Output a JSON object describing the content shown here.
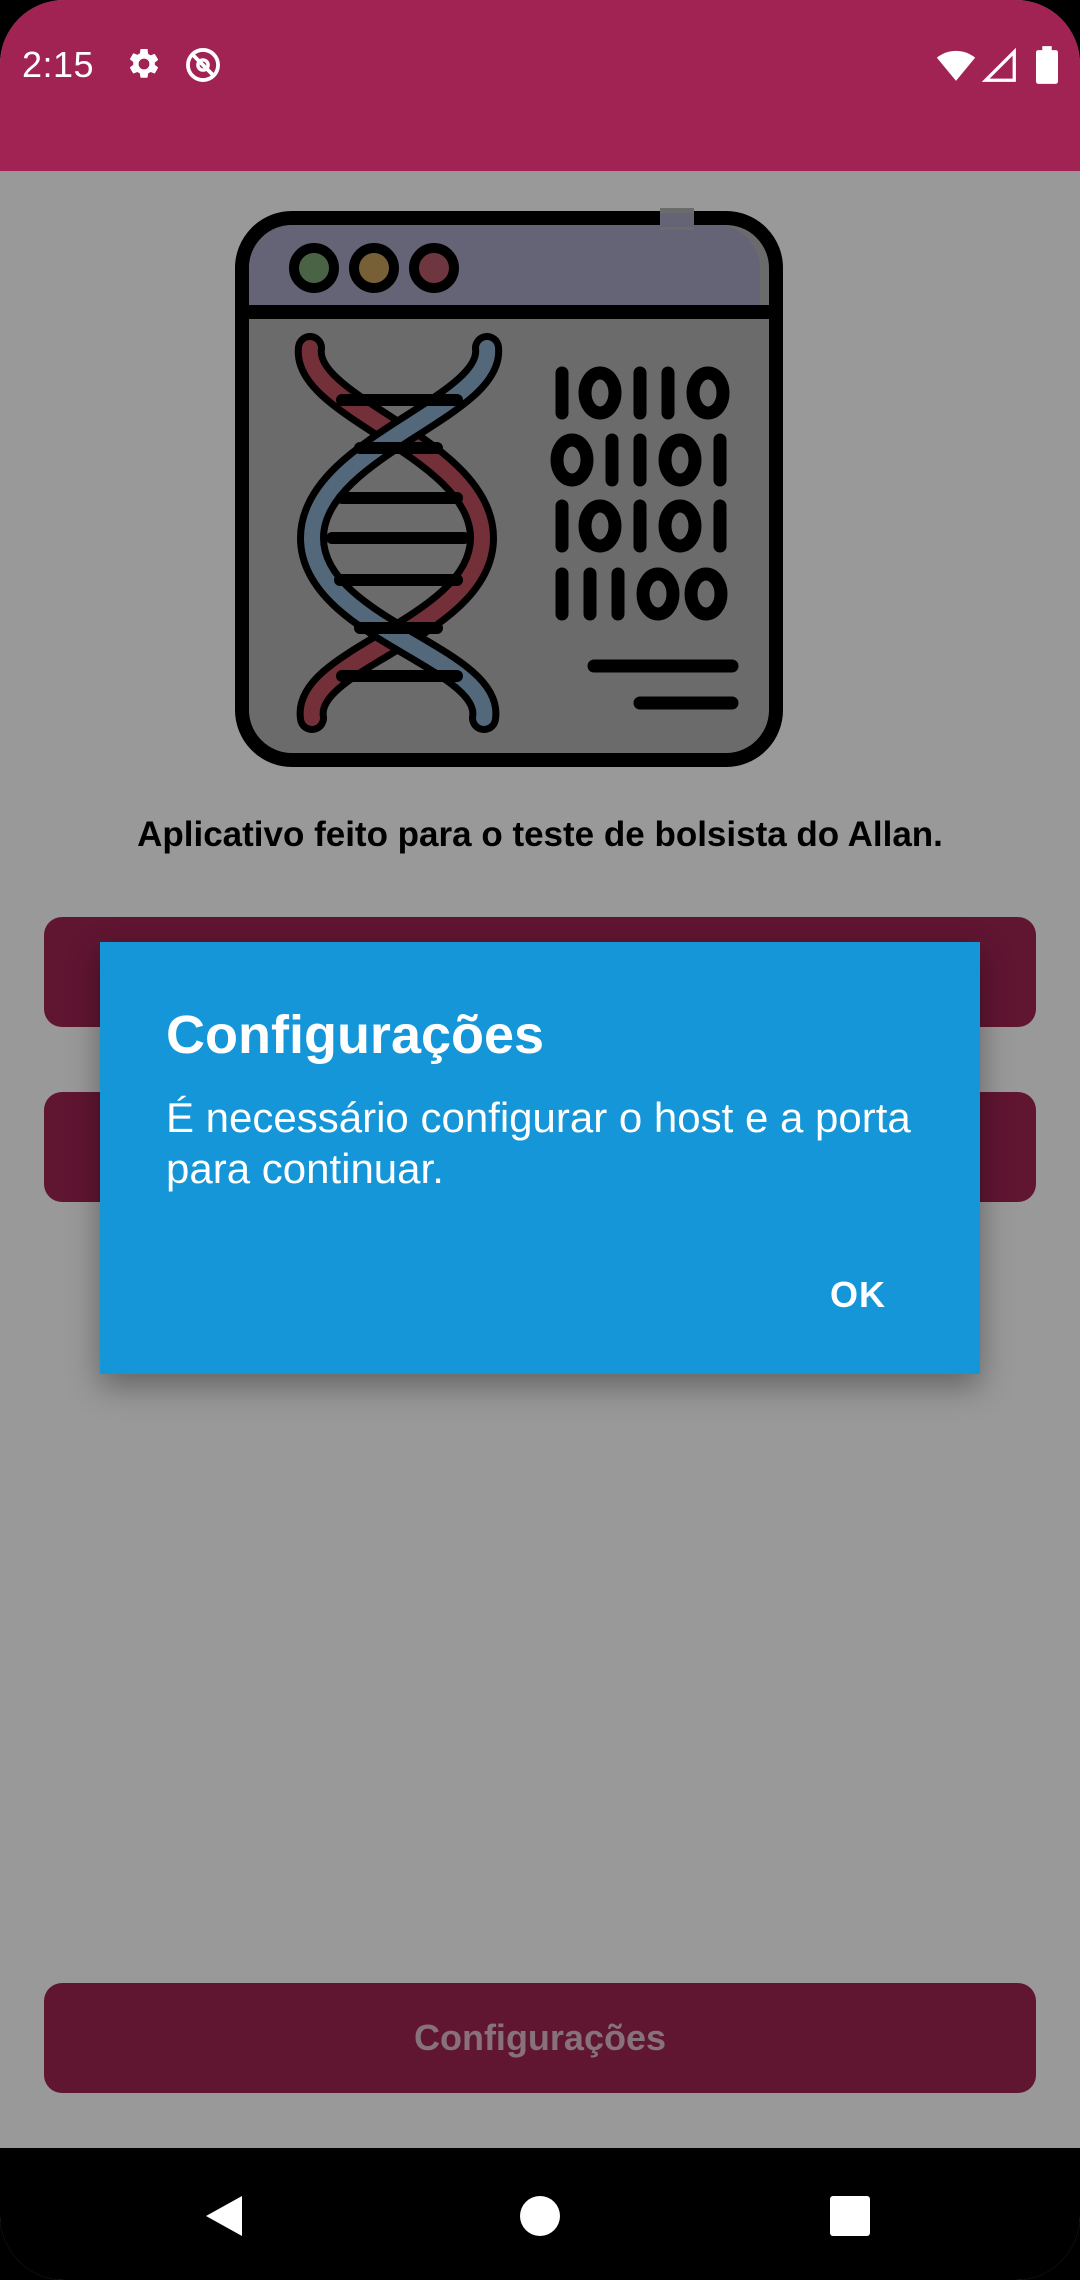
{
  "status_bar": {
    "time": "2:15",
    "icons": [
      "gear-icon",
      "do-not-disturb-icon",
      "wifi-icon",
      "signal-icon",
      "battery-icon"
    ],
    "background_color": "#a02353"
  },
  "main": {
    "illustration_icon": "dna-binary-code-browser-icon",
    "description": "Aplicativo feito para o teste de bolsista do Allan.",
    "settings_button_label": "Configurações",
    "accent_color": "#a02353"
  },
  "dialog": {
    "title": "Configurações",
    "message": "É necessário configurar o host e a porta para continuar.",
    "ok_label": "OK",
    "background_color": "#1496d8"
  },
  "navigation_bar": {
    "icons": [
      "back-icon",
      "home-icon",
      "recents-icon"
    ]
  }
}
